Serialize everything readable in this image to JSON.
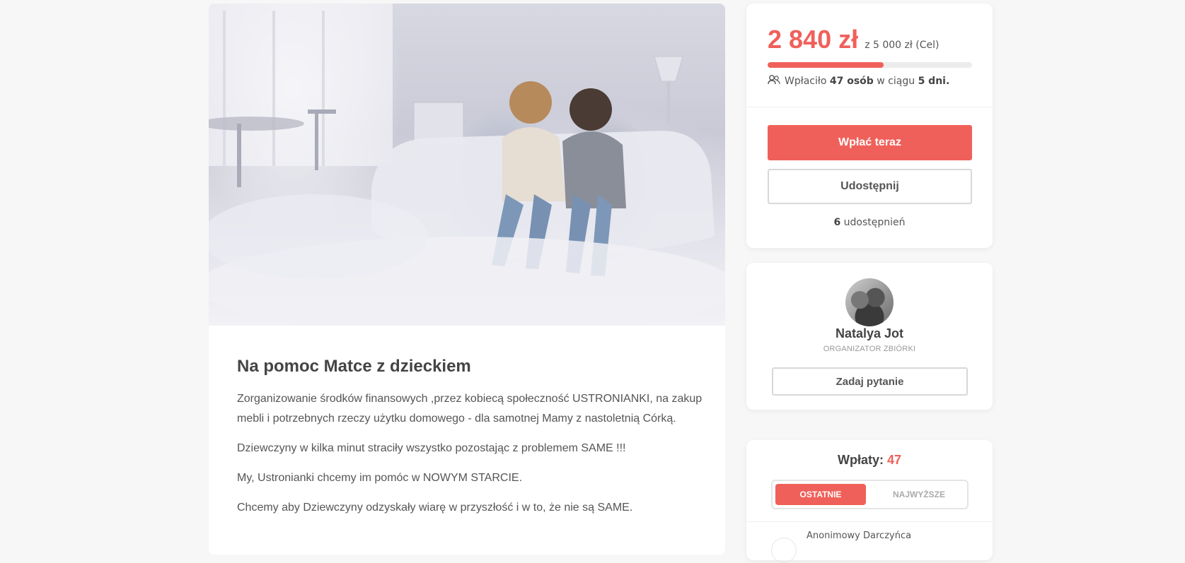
{
  "campaign": {
    "title": "Na pomoc Matce z dzieckiem",
    "paragraphs": [
      "Zorganizowanie środków finansowych ,przez kobiecą społeczność USTRONIANKI, na zakup mebli i potrzebnych rzeczy użytku domowego - dla samotnej Mamy z nastoletnią Córką.",
      "Dziewczyny w kilka minut straciły wszystko pozostając z problemem SAME !!!",
      "My, Ustronianki chcemy im pomóc w NOWYM STARCIE.",
      "Chcemy aby Dziewczyny odzyskały wiarę w przyszłość i w to, że nie są SAME."
    ]
  },
  "donate": {
    "raised": "2 840 zł",
    "goal_text": "z 5 000 zł (Cel)",
    "progress_fraction": 0.568,
    "donors_prefix": "Wpłaciło",
    "donors_count": "47 osób",
    "donors_middle": "w ciągu",
    "days": "5 dni.",
    "donate_label": "Wpłać teraz",
    "share_label": "Udostępnij",
    "shares_count": "6",
    "shares_suffix": "udostępnień"
  },
  "organizer": {
    "name": "Natalya Jot",
    "role": "ORGANIZATOR ZBIÓRKI",
    "ask_label": "Zadaj pytanie"
  },
  "payments": {
    "title": "Wpłaty:",
    "count": "47",
    "tabs": [
      "OSTATNIE",
      "NAJWYŻSZE"
    ],
    "first_donor": "Anonimowy Darczyńca"
  },
  "colors": {
    "accent": "#f0605a",
    "background": "#f7f7f7"
  },
  "icons": {
    "donors": "people-icon"
  }
}
